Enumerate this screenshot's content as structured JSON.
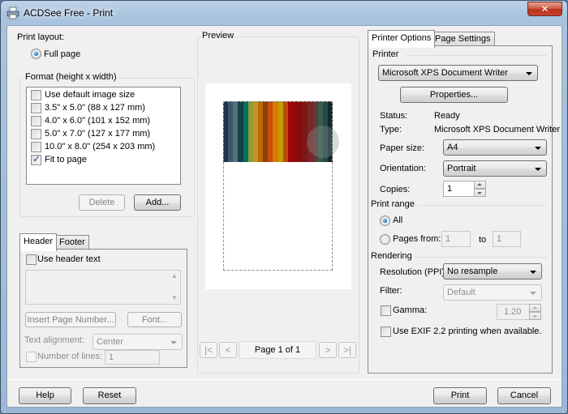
{
  "window": {
    "title": "ACDSee Free - Print",
    "close_glyph": "✕"
  },
  "print_layout": {
    "label": "Print layout:",
    "full_page_label": "Full page",
    "full_page_selected": true
  },
  "format": {
    "title": "Format (height x width)",
    "items": [
      {
        "label": "Use default image size",
        "checked": false
      },
      {
        "label": "3.5\" x 5.0\" (88 x 127 mm)",
        "checked": false
      },
      {
        "label": "4.0\" x 6.0\" (101 x 152 mm)",
        "checked": false
      },
      {
        "label": "5.0\" x 7.0\" (127 x 177 mm)",
        "checked": false
      },
      {
        "label": "10.0\" x 8.0\" (254 x 203 mm)",
        "checked": false
      },
      {
        "label": "Fit to page",
        "checked": true
      }
    ],
    "delete_label": "Delete",
    "add_label": "Add..."
  },
  "header_footer": {
    "tabs": [
      "Header",
      "Footer"
    ],
    "active_tab": "Header",
    "use_header_text_label": "Use header text",
    "use_header_text_checked": false,
    "header_text_value": "",
    "insert_page_number_label": "Insert Page Number...",
    "font_label": "Font...",
    "text_alignment_label": "Text alignment:",
    "text_alignment_value": "Center",
    "number_of_lines_label": "Number of lines:",
    "number_of_lines_checked": false,
    "number_of_lines_value": "1"
  },
  "preview": {
    "title": "Preview",
    "page_indicator": "Page 1 of 1",
    "nav": {
      "first": "|<",
      "prev": "<",
      "next": ">",
      "last": ">|"
    },
    "image_stripes": [
      "#1f3050",
      "#3d5569",
      "#596f77",
      "#0f4145",
      "#0d6b5e",
      "#8e9e34",
      "#c7941f",
      "#b96a0b",
      "#8f3d0a",
      "#c2510b",
      "#d57b06",
      "#c29b06",
      "#b84d0a",
      "#9c0707",
      "#940808",
      "#850d0d",
      "#7b1818",
      "#7a2626",
      "#5d3a35",
      "#3a5b4f",
      "#26484a",
      "#13272e"
    ]
  },
  "printer_options": {
    "tabs": [
      "Printer Options",
      "Page Settings"
    ],
    "active_tab": "Printer Options",
    "printer_group": "Printer",
    "printer_value": "Microsoft XPS Document Writer",
    "properties_label": "Properties...",
    "status_label": "Status:",
    "status_value": "Ready",
    "type_label": "Type:",
    "type_value": "Microsoft XPS Document Writer",
    "paper_size_label": "Paper size:",
    "paper_size_value": "A4",
    "orientation_label": "Orientation:",
    "orientation_value": "Portrait",
    "copies_label": "Copies:",
    "copies_value": "1",
    "print_range_group": "Print range",
    "all_label": "All",
    "all_selected": true,
    "pages_from_label": "Pages from:",
    "pages_from_value": "1",
    "to_label": "to",
    "pages_to_value": "1",
    "rendering_group": "Rendering",
    "resolution_label": "Resolution (PPI):",
    "resolution_value": "No resample",
    "filter_label": "Filter:",
    "filter_value": "Default",
    "gamma_label": "Gamma:",
    "gamma_checked": false,
    "gamma_value": "1.20",
    "exif_label": "Use EXIF 2.2 printing when available.",
    "exif_checked": false
  },
  "footer": {
    "help_label": "Help",
    "reset_label": "Reset",
    "print_label": "Print",
    "cancel_label": "Cancel"
  }
}
